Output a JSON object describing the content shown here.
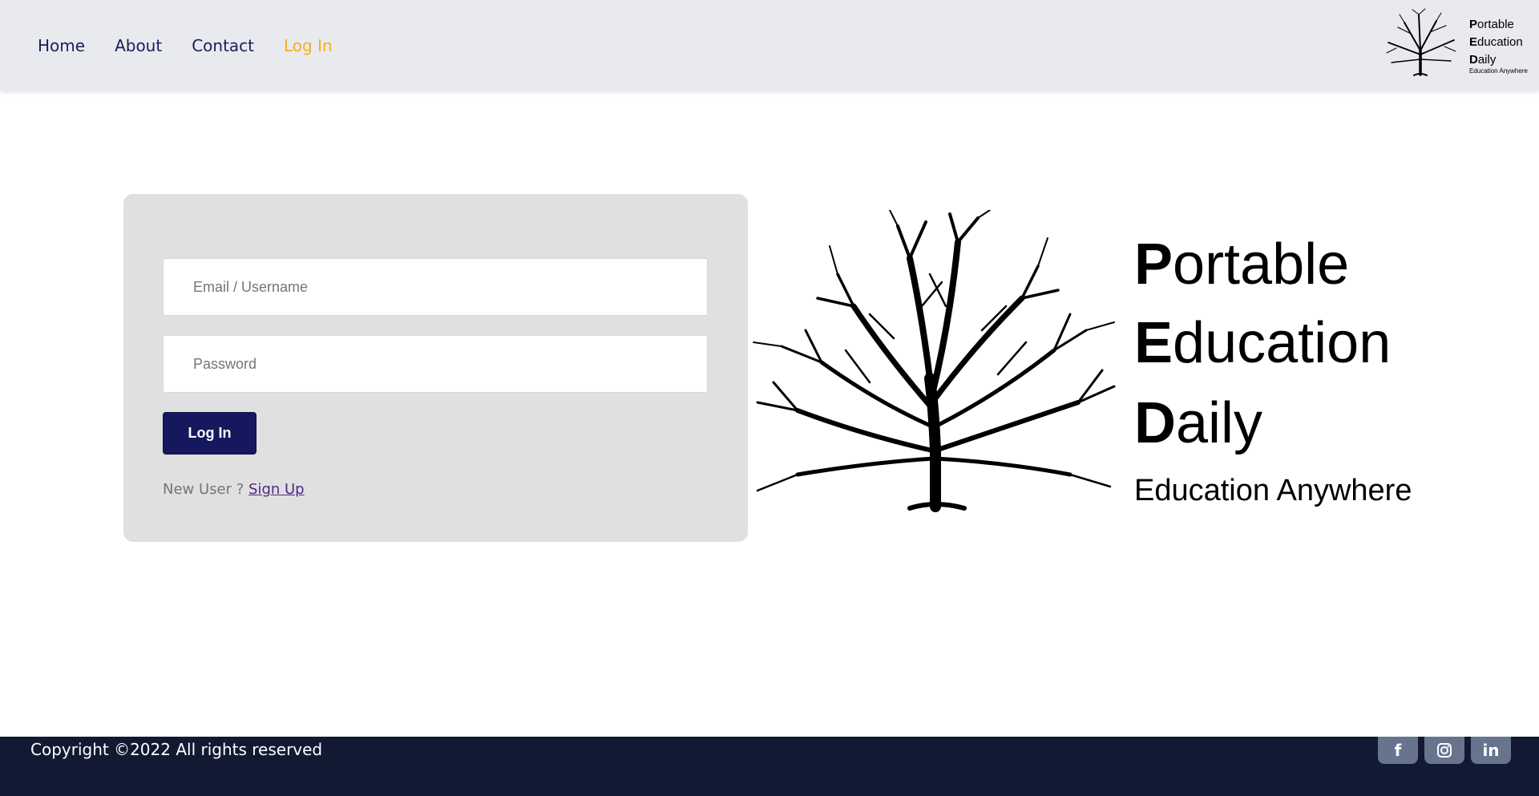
{
  "nav": {
    "links": [
      {
        "label": "Home"
      },
      {
        "label": "About"
      },
      {
        "label": "Contact"
      },
      {
        "label": "Log In",
        "active": true
      }
    ],
    "active_color": "#f0b023",
    "link_color": "#1b1e5c",
    "logo": {
      "lines": [
        {
          "initial": "P",
          "rest": "ortable"
        },
        {
          "initial": "E",
          "rest": "ducation"
        },
        {
          "initial": "D",
          "rest": "aily"
        }
      ],
      "tagline": "Education Anywhere"
    }
  },
  "login": {
    "email_placeholder": "Email / Username",
    "password_placeholder": "Password",
    "button_label": "Log In",
    "new_user_text": "New User ? ",
    "signup_label": "Sign Up"
  },
  "hero": {
    "lines": [
      {
        "initial": "P",
        "rest": "ortable"
      },
      {
        "initial": "E",
        "rest": "ducation"
      },
      {
        "initial": "D",
        "rest": "aily"
      }
    ],
    "tagline": "Education Anywhere"
  },
  "footer": {
    "copyright": "Copyright ©2022 All rights reserved",
    "social": [
      {
        "icon": "facebook-icon",
        "glyph": "f"
      },
      {
        "icon": "instagram-icon"
      },
      {
        "icon": "linkedin-icon",
        "glyph": "in"
      }
    ],
    "background": "#121a33",
    "icon_bg": "#66758d"
  },
  "colors": {
    "nav_bg": "#e9eaee",
    "card_bg": "#e0e0e0",
    "button_bg": "#16185e"
  }
}
